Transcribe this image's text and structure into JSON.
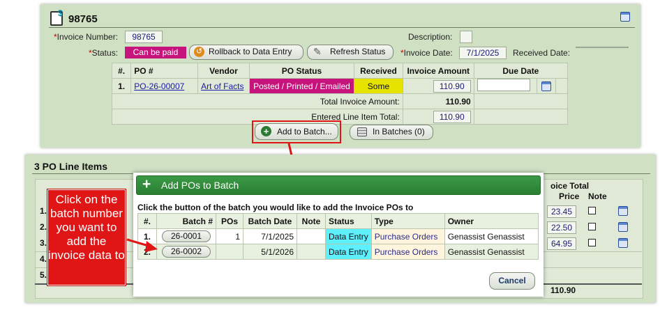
{
  "invoice": {
    "title": "98765",
    "invoice_number_label": "Invoice Number:",
    "invoice_number": "98765",
    "description_label": "Description:",
    "status_label": "Status:",
    "status_value": "Can be paid",
    "rollback_label": "Rollback to Data Entry",
    "refresh_label": "Refresh Status",
    "invoice_date_label": "Invoice Date:",
    "invoice_date": "7/1/2025",
    "received_date_label": "Received Date:",
    "table_headers": [
      "#.",
      "PO #",
      "Vendor",
      "PO Status",
      "Received",
      "Invoice Amount",
      "Due Date"
    ],
    "row": {
      "num": "1.",
      "po": "PO-26-00007",
      "vendor": "Art of Facts",
      "po_status": "Posted / Printed / Emailed",
      "received": "Some",
      "amount": "110.90"
    },
    "total_label": "Total Invoice Amount:",
    "total_value": "110.90",
    "entered_label": "Entered Line Item Total:",
    "entered_value": "110.90",
    "add_to_batch_label": "Add to Batch...",
    "in_batches_label": "In Batches (0)"
  },
  "line_items": {
    "title": "3 PO Line Items",
    "invoice_total_header": "oice Total",
    "price_header": "Price",
    "note_header": "Note",
    "rows": [
      {
        "num": "1.",
        "price": "23.45"
      },
      {
        "num": "2.",
        "price": "22.50"
      },
      {
        "num": "3.",
        "price": "64.95"
      },
      {
        "num": "4.",
        "price": ""
      },
      {
        "num": "5.",
        "price": ""
      }
    ],
    "footer_total": "110.90"
  },
  "modal": {
    "title": "Add POs to Batch",
    "instruction": "Click the button of the batch you would like to add the Invoice POs to",
    "headers": [
      "#.",
      "Batch #",
      "POs",
      "Batch Date",
      "Note",
      "Status",
      "Type",
      "Owner"
    ],
    "rows": [
      {
        "num": "1.",
        "batch": "26-0001",
        "pos": "1",
        "date": "7/1/2025",
        "note": "",
        "status": "Data Entry",
        "type": "Purchase Orders",
        "owner": "Genassist Genassist"
      },
      {
        "num": "2.",
        "batch": "26-0002",
        "pos": "",
        "date": "5/1/2026",
        "note": "",
        "status": "Data Entry",
        "type": "Purchase Orders",
        "owner": "Genassist Genassist"
      }
    ],
    "cancel_label": "Cancel"
  },
  "callout": {
    "text": "Click on the batch number you want to add the invoice data to"
  },
  "colors": {
    "panel_bg": "#cfe0c3",
    "modal_header": "#2f8f3a",
    "status_magenta": "#c7147c",
    "received_yellow": "#e6e300",
    "status_cyan": "#5ff0ff",
    "type_bg": "#fff5dd",
    "callout_red": "#e01616"
  }
}
